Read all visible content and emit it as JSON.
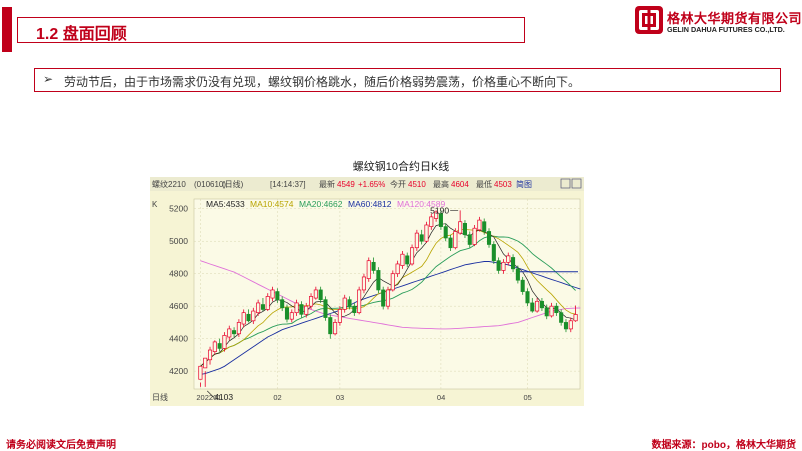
{
  "header": {
    "section_title": "1.2 盘面回顾"
  },
  "logo": {
    "name_cn": "格林大华期货有限公司",
    "name_en": "GELIN DAHUA FUTURES CO.,LTD."
  },
  "bullet": {
    "marker": "➢",
    "text": "劳动节后，由于市场需求仍没有兑现，螺纹钢价格跳水，随后价格弱势震荡，价格重心不断向下。"
  },
  "footer": {
    "disclaimer": "请务必阅读文后免责声明",
    "source": "数据来源：pobo，格林大华期货"
  },
  "colors": {
    "brand_red": "#c0001a",
    "up_candle": "#e8002a",
    "down_candle": "#1a8f2a",
    "ma5": "#222222",
    "ma10": "#b8a400",
    "ma20": "#2a9d5a",
    "ma60": "#1a2fa0",
    "ma120": "#e070d8"
  },
  "chart_data": {
    "type": "candlestick",
    "title": "螺纹钢10合约日K线",
    "toolbar": {
      "symbol": "螺纹2210",
      "code": "(010610)",
      "period": "(日线)",
      "time": "[14:14:37]",
      "latest_label": "最新",
      "latest": "4549",
      "change": "+1.65%",
      "open_label": "今开",
      "open": "4510",
      "high_label": "最高",
      "high": "4604",
      "low_label": "最低",
      "low": "4503",
      "button": "简图"
    },
    "ma_legend": [
      {
        "name": "MA5:4533",
        "color": "#222222"
      },
      {
        "name": "MA10:4574",
        "color": "#b8a400"
      },
      {
        "name": "MA20:4662",
        "color": "#2a9d5a"
      },
      {
        "name": "MA60:4812",
        "color": "#1a2fa0"
      },
      {
        "name": "MA120:4589",
        "color": "#e070d8"
      }
    ],
    "k_label": "K",
    "y_ticks": [
      4200,
      4400,
      4600,
      4800,
      5000,
      5200
    ],
    "ylim": [
      4090,
      5260
    ],
    "x_ticks": [
      {
        "label": "202201",
        "index": 0
      },
      {
        "label": "02",
        "index": 16
      },
      {
        "label": "03",
        "index": 29
      },
      {
        "label": "04",
        "index": 50
      },
      {
        "label": "05",
        "index": 68
      }
    ],
    "period_label": "日线",
    "annotations": [
      {
        "text": "5190",
        "index": 54,
        "value": 5190,
        "side": "left",
        "kind": "high"
      },
      {
        "text": "4103",
        "index": 1,
        "value": 4103,
        "side": "right",
        "kind": "low"
      }
    ],
    "hline": {
      "value": 4812,
      "from_index": 66
    },
    "candles": [
      [
        4150,
        4230,
        4130,
        4103
      ],
      [
        4220,
        4280,
        4200,
        4103
      ],
      [
        4270,
        4330,
        4240,
        4350
      ],
      [
        4320,
        4380,
        4300,
        4390
      ],
      [
        4370,
        4340,
        4320,
        4400
      ],
      [
        4340,
        4420,
        4320,
        4440
      ],
      [
        4410,
        4460,
        4390,
        4480
      ],
      [
        4450,
        4430,
        4410,
        4470
      ],
      [
        4430,
        4500,
        4410,
        4520
      ],
      [
        4490,
        4560,
        4470,
        4580
      ],
      [
        4550,
        4510,
        4500,
        4580
      ],
      [
        4510,
        4570,
        4490,
        4590
      ],
      [
        4560,
        4620,
        4540,
        4640
      ],
      [
        4610,
        4580,
        4570,
        4650
      ],
      [
        4580,
        4660,
        4570,
        4680
      ],
      [
        4650,
        4700,
        4630,
        4720
      ],
      [
        4690,
        4640,
        4620,
        4710
      ],
      [
        4640,
        4590,
        4570,
        4660
      ],
      [
        4590,
        4520,
        4500,
        4610
      ],
      [
        4520,
        4560,
        4500,
        4580
      ],
      [
        4560,
        4620,
        4540,
        4640
      ],
      [
        4610,
        4550,
        4530,
        4630
      ],
      [
        4550,
        4600,
        4530,
        4620
      ],
      [
        4600,
        4660,
        4580,
        4680
      ],
      [
        4650,
        4700,
        4640,
        4720
      ],
      [
        4700,
        4640,
        4620,
        4720
      ],
      [
        4640,
        4530,
        4510,
        4660
      ],
      [
        4530,
        4430,
        4400,
        4550
      ],
      [
        4430,
        4500,
        4420,
        4520
      ],
      [
        4500,
        4580,
        4480,
        4600
      ],
      [
        4580,
        4650,
        4560,
        4670
      ],
      [
        4640,
        4600,
        4580,
        4660
      ],
      [
        4600,
        4560,
        4540,
        4620
      ],
      [
        4560,
        4700,
        4550,
        4720
      ],
      [
        4700,
        4780,
        4680,
        4800
      ],
      [
        4770,
        4880,
        4750,
        4900
      ],
      [
        4870,
        4820,
        4800,
        4900
      ],
      [
        4820,
        4700,
        4680,
        4840
      ],
      [
        4700,
        4600,
        4580,
        4720
      ],
      [
        4600,
        4700,
        4580,
        4720
      ],
      [
        4700,
        4800,
        4690,
        4820
      ],
      [
        4800,
        4860,
        4780,
        4880
      ],
      [
        4850,
        4920,
        4830,
        4940
      ],
      [
        4910,
        4860,
        4840,
        4930
      ],
      [
        4860,
        4960,
        4850,
        4980
      ],
      [
        4960,
        5050,
        4940,
        5070
      ],
      [
        5040,
        5000,
        4980,
        5070
      ],
      [
        5000,
        5100,
        4990,
        5120
      ],
      [
        5090,
        5150,
        5070,
        5170
      ],
      [
        5140,
        5180,
        5120,
        5190
      ],
      [
        5170,
        5090,
        5070,
        5190
      ],
      [
        5090,
        5020,
        5000,
        5110
      ],
      [
        5020,
        4960,
        4940,
        5040
      ],
      [
        4960,
        5060,
        4950,
        5080
      ],
      [
        5050,
        5120,
        5040,
        5190
      ],
      [
        5110,
        5040,
        5020,
        5130
      ],
      [
        5040,
        4980,
        4960,
        5060
      ],
      [
        4980,
        5080,
        4970,
        5100
      ],
      [
        5070,
        5130,
        5060,
        5150
      ],
      [
        5120,
        5060,
        5040,
        5140
      ],
      [
        5060,
        4980,
        4960,
        5080
      ],
      [
        4980,
        4880,
        4860,
        5000
      ],
      [
        4880,
        4820,
        4800,
        4900
      ],
      [
        4820,
        4870,
        4800,
        4890
      ],
      [
        4870,
        4910,
        4850,
        4930
      ],
      [
        4900,
        4830,
        4810,
        4920
      ],
      [
        4830,
        4760,
        4740,
        4850
      ],
      [
        4760,
        4690,
        4670,
        4780
      ],
      [
        4690,
        4620,
        4600,
        4710
      ],
      [
        4620,
        4570,
        4560,
        4650
      ],
      [
        4570,
        4630,
        4560,
        4650
      ],
      [
        4630,
        4590,
        4570,
        4650
      ],
      [
        4590,
        4540,
        4520,
        4610
      ],
      [
        4540,
        4600,
        4530,
        4620
      ],
      [
        4600,
        4560,
        4540,
        4620
      ],
      [
        4560,
        4500,
        4480,
        4580
      ],
      [
        4500,
        4460,
        4440,
        4520
      ],
      [
        4460,
        4510,
        4440,
        4530
      ],
      [
        4510,
        4549,
        4503,
        4604
      ]
    ],
    "ma60_series": [
      4180,
      4185,
      4195,
      4205,
      4215,
      4230,
      4250,
      4270,
      4290,
      4310,
      4330,
      4350,
      4370,
      4390,
      4410,
      4425,
      4440,
      4455,
      4465,
      4475,
      4485,
      4495,
      4505,
      4515,
      4525,
      4535,
      4545,
      4555,
      4565,
      4575,
      4590,
      4605,
      4620,
      4635,
      4645,
      4655,
      4665,
      4675,
      4685,
      4695,
      4705,
      4715,
      4725,
      4735,
      4745,
      4755,
      4765,
      4775,
      4785,
      4795,
      4805,
      4815,
      4825,
      4835,
      4845,
      4855,
      4860,
      4865,
      4870,
      4875,
      4875,
      4870,
      4865,
      4860,
      4855,
      4845,
      4835,
      4825,
      4815,
      4805,
      4795,
      4785,
      4775,
      4765,
      4755,
      4745,
      4735,
      4725,
      4715,
      4705
    ],
    "ma120_series": [
      4880,
      4870,
      4860,
      4850,
      4840,
      4830,
      4820,
      4810,
      4795,
      4780,
      4765,
      4750,
      4735,
      4720,
      4705,
      4690,
      4675,
      4660,
      4645,
      4630,
      4615,
      4600,
      4590,
      4580,
      4570,
      4560,
      4550,
      4545,
      4540,
      4535,
      4530,
      4525,
      4520,
      4515,
      4510,
      4505,
      4500,
      4495,
      4490,
      4485,
      4480,
      4475,
      4470,
      4468,
      4466,
      4465,
      4464,
      4463,
      4462,
      4461,
      4460,
      4460,
      4461,
      4462,
      4464,
      4466,
      4468,
      4470,
      4472,
      4474,
      4476,
      4478,
      4480,
      4485,
      4490,
      4495,
      4500,
      4510,
      4520,
      4530,
      4540,
      4550,
      4560,
      4570,
      4575,
      4580,
      4585,
      4587,
      4588,
      4589
    ]
  }
}
